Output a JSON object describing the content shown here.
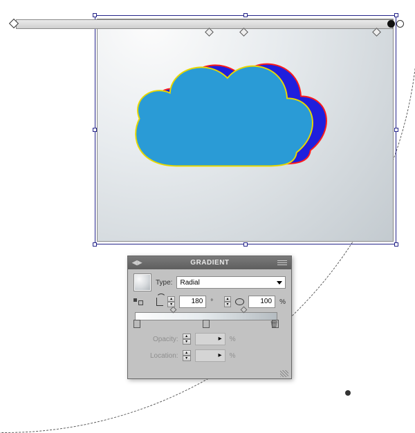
{
  "panel": {
    "title": "GRADIENT",
    "type_label": "Type:",
    "type_value": "Radial",
    "angle_value": "180",
    "angle_unit": "°",
    "aspect_value": "100",
    "aspect_unit": "%",
    "opacity_label": "Opacity:",
    "opacity_unit": "%",
    "location_label": "Location:",
    "location_unit": "%"
  },
  "colors": {
    "cloud_front": "#2A9BD6",
    "cloud_front_stroke": "#E8D800",
    "cloud_back": "#1F1FDD",
    "cloud_back_stroke": "#FF1A1A"
  },
  "icons": {
    "menu": "panel-menu-icon",
    "collapse": "collapse-arrows-icon",
    "reverse": "reverse-gradient-icon",
    "angle": "angle-icon",
    "ratio": "aspect-ratio-icon",
    "trash": "trash-icon",
    "grip": "resize-grip-icon"
  }
}
